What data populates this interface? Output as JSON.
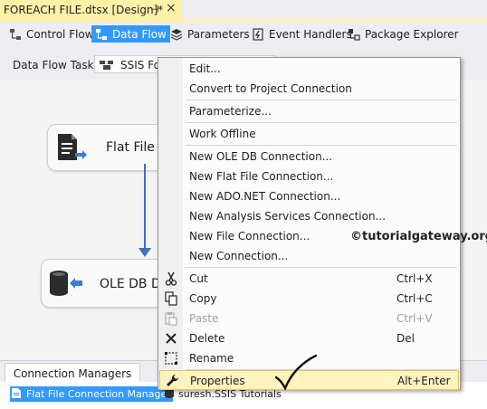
{
  "document_tab": {
    "title": "FOREACH FILE.dtsx [Design]*",
    "pin": "⊣",
    "close": "×"
  },
  "designer_tabs": [
    {
      "label": "Control Flow",
      "icon": "control-flow-icon"
    },
    {
      "label": "Data Flow",
      "icon": "data-flow-icon",
      "active": true
    },
    {
      "label": "Parameters",
      "icon": "parameters-icon"
    },
    {
      "label": "Event Handlers",
      "icon": "event-handlers-icon"
    },
    {
      "label": "Package Explorer",
      "icon": "package-explorer-icon"
    }
  ],
  "task_bar": {
    "label": "Data Flow Task:",
    "value": "SSIS For"
  },
  "canvas": {
    "components": [
      {
        "label": "Flat File",
        "icon": "flat-file-source-icon"
      },
      {
        "label": "OLE DB D",
        "icon": "ole-db-destination-icon"
      }
    ]
  },
  "context_menu": {
    "items": [
      {
        "label": "Edit...",
        "shortcut": "",
        "icon": "",
        "disabled": false
      },
      {
        "label": "Convert to Project Connection",
        "shortcut": "",
        "icon": "",
        "disabled": false
      },
      {
        "label": "Parameterize...",
        "shortcut": "",
        "icon": "",
        "disabled": false
      },
      {
        "label": "Work Offline",
        "shortcut": "",
        "icon": "",
        "disabled": false
      },
      {
        "label": "New OLE DB Connection...",
        "shortcut": "",
        "icon": "",
        "disabled": false
      },
      {
        "label": "New Flat File Connection...",
        "shortcut": "",
        "icon": "",
        "disabled": false
      },
      {
        "label": "New ADO.NET Connection...",
        "shortcut": "",
        "icon": "",
        "disabled": false
      },
      {
        "label": "New Analysis Services Connection...",
        "shortcut": "",
        "icon": "",
        "disabled": false
      },
      {
        "label": "New File Connection...",
        "shortcut": "",
        "icon": "",
        "disabled": false
      },
      {
        "label": "New Connection...",
        "shortcut": "",
        "icon": "",
        "disabled": false
      },
      {
        "label": "Cut",
        "shortcut": "Ctrl+X",
        "icon": "scissors-icon",
        "disabled": false
      },
      {
        "label": "Copy",
        "shortcut": "Ctrl+C",
        "icon": "copy-icon",
        "disabled": false
      },
      {
        "label": "Paste",
        "shortcut": "Ctrl+V",
        "icon": "paste-icon",
        "disabled": true
      },
      {
        "label": "Delete",
        "shortcut": "Del",
        "icon": "delete-x-icon",
        "disabled": false
      },
      {
        "label": "Rename",
        "shortcut": "",
        "icon": "rename-icon",
        "disabled": false
      },
      {
        "label": "Properties",
        "shortcut": "Alt+Enter",
        "icon": "wrench-icon",
        "disabled": false,
        "highlighted": true
      }
    ]
  },
  "watermark": "©tutorialgateway.org",
  "connection_managers": {
    "tab_label": "Connection Managers",
    "items": [
      {
        "label": "Flat File Connection Manager",
        "icon": "flat-file-connection-icon",
        "selected": true
      },
      {
        "label": "suresh.SSIS Tutorials",
        "icon": "ole-db-connection-icon",
        "selected": false
      }
    ]
  },
  "colors": {
    "accent": "#3399ff",
    "tab_yellow": "#fff1a8",
    "highlight": "#fff3c0",
    "flow_arrow": "#3b6fc4"
  }
}
